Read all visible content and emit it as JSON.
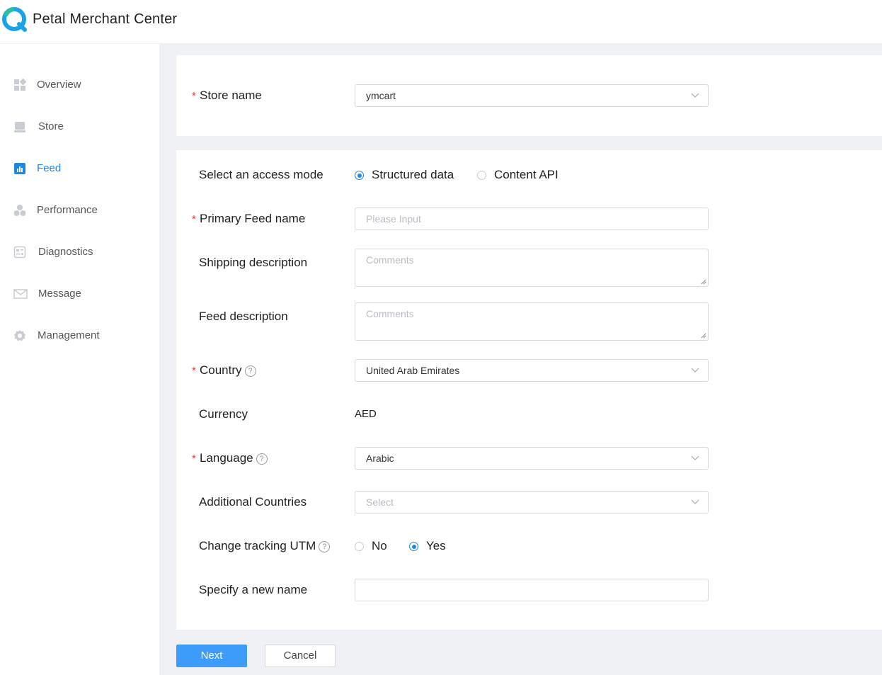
{
  "app": {
    "title": "Petal Merchant Center"
  },
  "sidebar": {
    "items": [
      {
        "label": "Overview",
        "icon": "dashboard-icon"
      },
      {
        "label": "Store",
        "icon": "store-icon"
      },
      {
        "label": "Feed",
        "icon": "feed-chart-icon",
        "active": true
      },
      {
        "label": "Performance",
        "icon": "performance-icon"
      },
      {
        "label": "Diagnostics",
        "icon": "diagnostics-icon"
      },
      {
        "label": "Message",
        "icon": "mail-icon"
      },
      {
        "label": "Management",
        "icon": "gear-icon"
      }
    ],
    "active_color": "#1e88e5"
  },
  "store": {
    "label": "Store name",
    "value": "ymcart"
  },
  "form": {
    "access_mode": {
      "label": "Select an access mode",
      "option_structured": "Structured data",
      "option_api": "Content API",
      "selected": "Structured data"
    },
    "primary_feed": {
      "label": "Primary Feed name",
      "placeholder": "Please Input"
    },
    "shipping": {
      "label": "Shipping description",
      "placeholder": "Comments"
    },
    "feed_desc": {
      "label": "Feed description",
      "placeholder": "Comments"
    },
    "country": {
      "label": "Country",
      "value": "United Arab Emirates"
    },
    "currency": {
      "label": "Currency",
      "value": "AED"
    },
    "language": {
      "label": "Language",
      "value": "Arabic"
    },
    "additional": {
      "label": "Additional Countries",
      "placeholder": "Select"
    },
    "utm": {
      "label": "Change tracking UTM",
      "option_no": "No",
      "option_yes": "Yes",
      "selected": "Yes"
    },
    "new_name": {
      "label": "Specify a new name",
      "value": ""
    },
    "required_mark": "*",
    "help_mark": "?"
  },
  "actions": {
    "next": "Next",
    "cancel": "Cancel"
  },
  "colors": {
    "accent": "#3d9bfa",
    "required": "#e53935",
    "page_bg": "#f0f1f5"
  }
}
